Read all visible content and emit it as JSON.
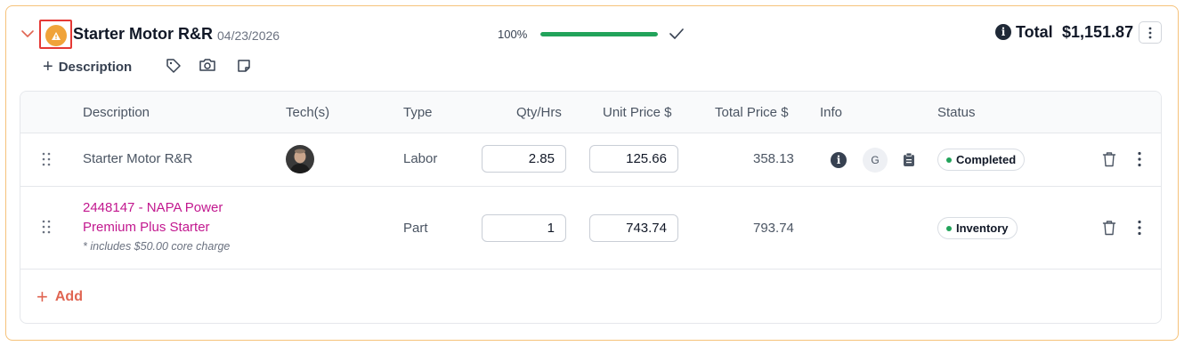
{
  "job": {
    "title": "Starter Motor R&R",
    "date": "04/23/2026",
    "progress_label": "100%",
    "progress_fraction": 1.0,
    "total_label": "Total",
    "total_value": "$1,151.87",
    "warning_icon": "warning-triangle-icon",
    "add_description_label": "Description",
    "toolbar_icons": [
      "tag-icon",
      "camera-icon",
      "note-icon"
    ]
  },
  "table": {
    "headers": {
      "description": "Description",
      "techs": "Tech(s)",
      "type": "Type",
      "qty": "Qty/Hrs",
      "unit_price": "Unit Price $",
      "total_price": "Total Price $",
      "info": "Info",
      "status": "Status"
    },
    "rows": [
      {
        "description": "Starter Motor R&R",
        "type": "Labor",
        "qty": "2.85",
        "unit_price": "125.66",
        "total_price": "358.13",
        "info_badge": "G",
        "status": "Completed"
      },
      {
        "description": "2448147 - NAPA Power Premium Plus Starter",
        "note": "* includes $50.00 core charge",
        "type": "Part",
        "qty": "1",
        "unit_price": "743.74",
        "total_price": "793.74",
        "status": "Inventory"
      }
    ],
    "add_label": "Add"
  },
  "colors": {
    "card_border": "#f5c27a",
    "warning": "#f0a33a",
    "highlight_box": "#e53935",
    "progress": "#22a35a",
    "part_link": "#c2188f",
    "add_accent": "#e06552",
    "status_dot": "#22a35a"
  }
}
